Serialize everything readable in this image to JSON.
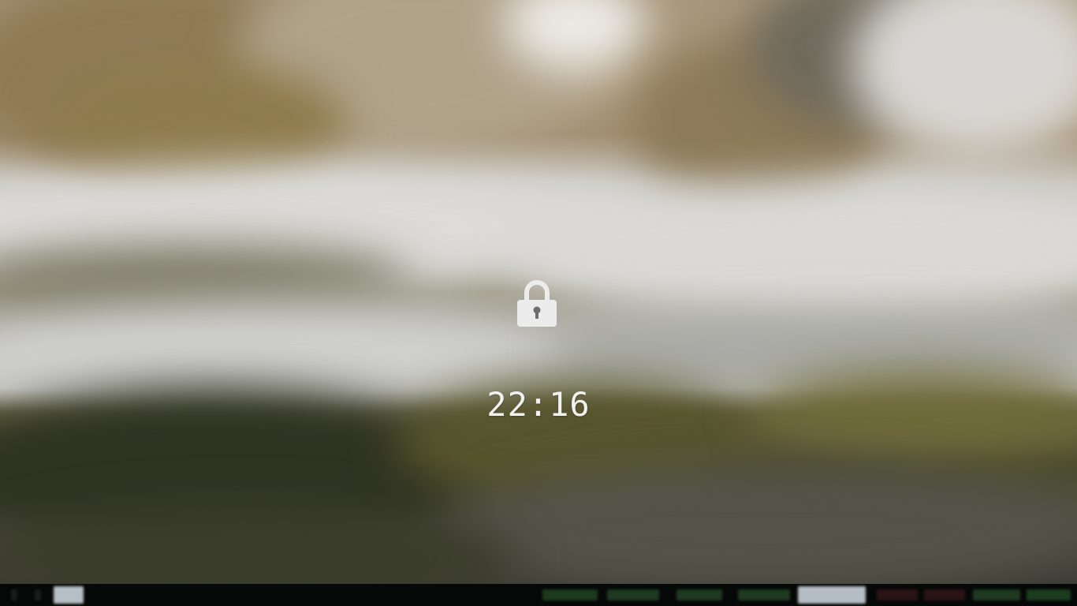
{
  "lock_screen": {
    "time": "22:16",
    "lock_icon": "lock-icon"
  },
  "panel": {
    "workspace_indicator": "workspace-indicator",
    "status_items": [
      "status-block-1",
      "status-block-2",
      "status-block-3",
      "status-block-4",
      "status-block-5",
      "status-block-6",
      "status-block-7",
      "status-block-8",
      "status-block-9"
    ]
  },
  "colors": {
    "panel_bg": "#060807",
    "clock_text": "#f2f2f2",
    "lock_icon": "#ececec",
    "status_green": "#2d5a2e",
    "status_highlight": "#b8c0c8"
  }
}
